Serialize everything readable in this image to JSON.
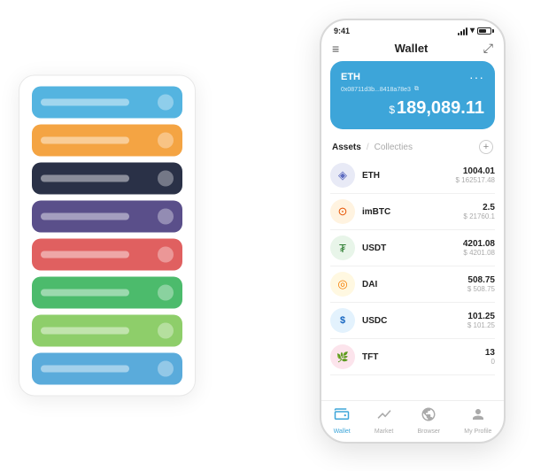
{
  "scene": {
    "cards": [
      {
        "color": "card-blue"
      },
      {
        "color": "card-orange"
      },
      {
        "color": "card-dark"
      },
      {
        "color": "card-purple"
      },
      {
        "color": "card-red"
      },
      {
        "color": "card-green"
      },
      {
        "color": "card-light-green"
      },
      {
        "color": "card-sky"
      }
    ]
  },
  "phone": {
    "status": {
      "time": "9:41"
    },
    "header": {
      "menu_icon": "≡",
      "title": "Wallet",
      "expand_icon": "⤢"
    },
    "eth_card": {
      "label": "ETH",
      "dots": "···",
      "address": "0x08711d3b...8418a78e3",
      "copy_icon": "⧉",
      "balance_symbol": "$",
      "balance": "189,089.11"
    },
    "assets": {
      "tab_active": "Assets",
      "separator": "/",
      "tab_inactive": "Collecties",
      "add_icon": "+"
    },
    "asset_list": [
      {
        "symbol": "ETH",
        "icon": "◈",
        "icon_class": "eth-coin",
        "amount": "1004.01",
        "usd": "$ 162517.48"
      },
      {
        "symbol": "imBTC",
        "icon": "⊙",
        "icon_class": "imbtc-coin",
        "amount": "2.5",
        "usd": "$ 21760.1"
      },
      {
        "symbol": "USDT",
        "icon": "₮",
        "icon_class": "usdt-coin",
        "amount": "4201.08",
        "usd": "$ 4201.08"
      },
      {
        "symbol": "DAI",
        "icon": "◎",
        "icon_class": "dai-coin",
        "amount": "508.75",
        "usd": "$ 508.75"
      },
      {
        "symbol": "USDC",
        "icon": "$",
        "icon_class": "usdc-coin",
        "amount": "101.25",
        "usd": "$ 101.25"
      },
      {
        "symbol": "TFT",
        "icon": "🌿",
        "icon_class": "tft-coin",
        "amount": "13",
        "usd": "0"
      }
    ],
    "bottom_nav": [
      {
        "label": "Wallet",
        "icon": "◎",
        "active": true
      },
      {
        "label": "Market",
        "icon": "📈",
        "active": false
      },
      {
        "label": "Browser",
        "icon": "👤",
        "active": false
      },
      {
        "label": "My Profile",
        "icon": "👤",
        "active": false
      }
    ]
  }
}
